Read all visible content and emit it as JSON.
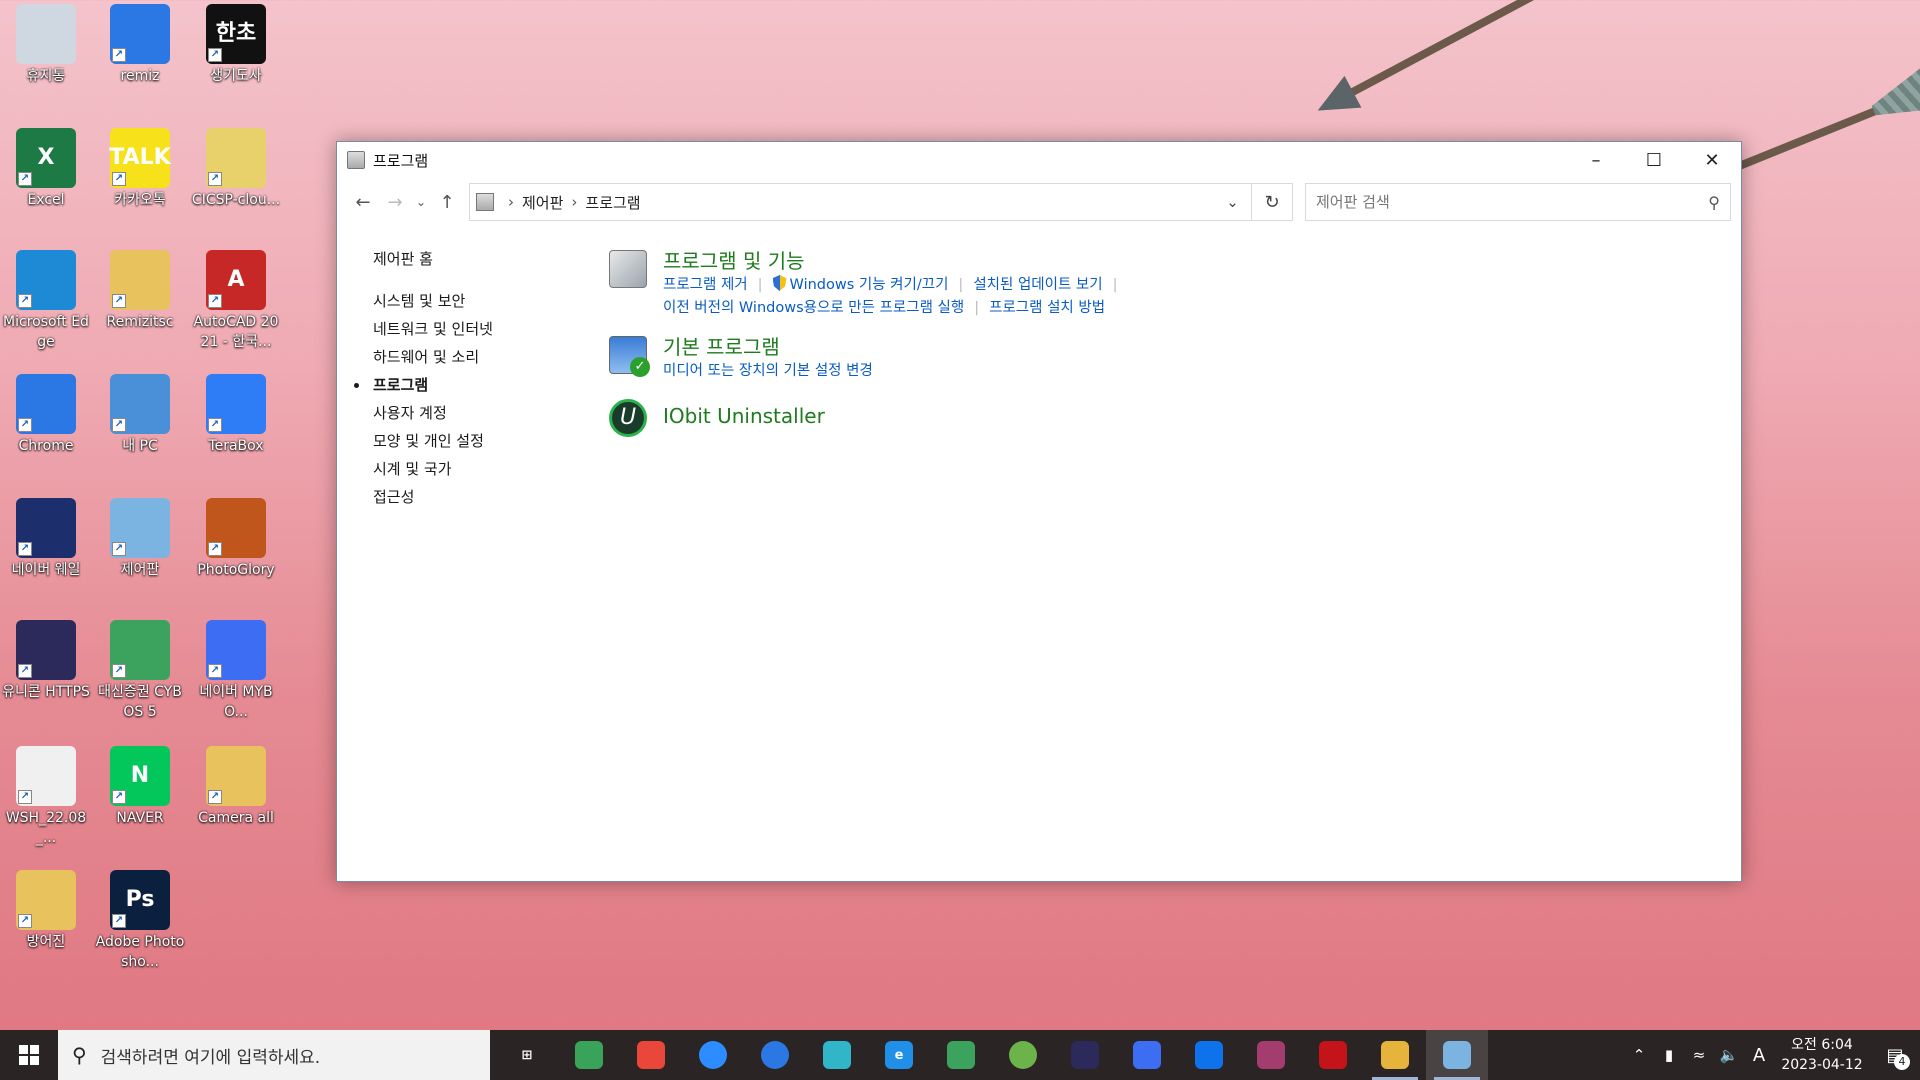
{
  "desktop": {
    "icons": [
      {
        "label": "휴지통",
        "icon": "recycle-bin-icon",
        "color": "#cfd8e0"
      },
      {
        "label": "remiz",
        "icon": "chrome-icon",
        "color": "#2b78e4"
      },
      {
        "label": "생기도사",
        "icon": "app-icon",
        "color": "#111111",
        "glyph": "한초"
      },
      {
        "label": "Excel",
        "icon": "excel-icon",
        "color": "#1d7a45",
        "glyph": "X"
      },
      {
        "label": "카카오톡",
        "icon": "kakaotalk-icon",
        "color": "#f7e11b",
        "glyph": "TALK"
      },
      {
        "label": "CICSP-clou...",
        "icon": "cloud-app-icon",
        "color": "#e8d16a"
      },
      {
        "label": "Microsoft Edge",
        "icon": "edge-icon",
        "color": "#1e8ad6"
      },
      {
        "label": "Remizitsc",
        "icon": "folder-user-icon",
        "color": "#e7c25d"
      },
      {
        "label": "AutoCAD 2021 - 한국...",
        "icon": "autocad-icon",
        "color": "#c62828",
        "glyph": "A"
      },
      {
        "label": "Chrome",
        "icon": "chrome-icon",
        "color": "#2b78e4"
      },
      {
        "label": "내 PC",
        "icon": "pc-icon",
        "color": "#4a90d9"
      },
      {
        "label": "TeraBox",
        "icon": "terabox-icon",
        "color": "#2f7df6"
      },
      {
        "label": "네이버 웨일",
        "icon": "whale-icon",
        "color": "#1c2e6b"
      },
      {
        "label": "제어판",
        "icon": "control-panel-icon",
        "color": "#7bb4e0"
      },
      {
        "label": "PhotoGlory",
        "icon": "photoglory-icon",
        "color": "#c0561c"
      },
      {
        "label": "유니콘 HTTPS",
        "icon": "unicorn-https-icon",
        "color": "#2c2a5a"
      },
      {
        "label": "대신증권 CYBOS 5",
        "icon": "cybos-icon",
        "color": "#3ba35d"
      },
      {
        "label": "네이버 MYBO...",
        "icon": "mybox-icon",
        "color": "#3d6df2"
      },
      {
        "label": "WSH_22.08_...",
        "icon": "file-icon",
        "color": "#f0f0f0"
      },
      {
        "label": "NAVER",
        "icon": "naver-icon",
        "color": "#03c75a",
        "glyph": "N"
      },
      {
        "label": "Camera all",
        "icon": "folder-photo-icon",
        "color": "#e7c25d"
      },
      {
        "label": "방어진",
        "icon": "folder-excel-icon",
        "color": "#e7c25d"
      },
      {
        "label": "Adobe Photosho...",
        "icon": "photoshop-icon",
        "color": "#0b1f3f",
        "glyph": "Ps"
      }
    ]
  },
  "window": {
    "title": "프로그램",
    "breadcrumb": [
      "제어판",
      "프로그램"
    ],
    "search_placeholder": "제어판 검색",
    "leftnav": {
      "home": "제어판 홈",
      "items": [
        {
          "label": "시스템 및 보안",
          "active": false
        },
        {
          "label": "네트워크 및 인터넷",
          "active": false
        },
        {
          "label": "하드웨어 및 소리",
          "active": false
        },
        {
          "label": "프로그램",
          "active": true
        },
        {
          "label": "사용자 계정",
          "active": false
        },
        {
          "label": "모양 및 개인 설정",
          "active": false
        },
        {
          "label": "시계 및 국가",
          "active": false
        },
        {
          "label": "접근성",
          "active": false
        }
      ]
    },
    "categories": {
      "programs_features": {
        "heading": "프로그램 및 기능",
        "link1": "프로그램 제거",
        "link2": "Windows 기능 켜기/끄기",
        "link3": "설치된 업데이트 보기",
        "link4": "이전 버전의 Windows용으로 만든 프로그램 실행",
        "link5": "프로그램 설치 방법"
      },
      "default_programs": {
        "heading": "기본 프로그램",
        "link1": "미디어 또는 장치의 기본 설정 변경"
      },
      "iobit": {
        "heading": "IObit Uninstaller"
      }
    }
  },
  "taskbar": {
    "search_placeholder": "검색하려면 여기에 입력하세요.",
    "apps": [
      {
        "name": "task-view-icon",
        "color": "#2a2424",
        "glyph": "⊞"
      },
      {
        "name": "globe-app-icon",
        "color": "#3aa35a"
      },
      {
        "name": "snap-app-icon",
        "color": "#e8473a"
      },
      {
        "name": "zoom-icon",
        "color": "#2d8cff"
      },
      {
        "name": "chrome-icon",
        "color": "#2b78e4"
      },
      {
        "name": "whale-icon",
        "color": "#30b5c9"
      },
      {
        "name": "ie-icon",
        "color": "#1f8fe8",
        "glyph": "e"
      },
      {
        "name": "green-app-icon",
        "color": "#3ba35d"
      },
      {
        "name": "utorrent-icon",
        "color": "#6bb34a"
      },
      {
        "name": "unicorn-https-icon",
        "color": "#2c2a5a"
      },
      {
        "name": "mybox-icon",
        "color": "#3d6df2"
      },
      {
        "name": "teamviewer-icon",
        "color": "#0e72ed"
      },
      {
        "name": "winrar-icon",
        "color": "#a33c6f"
      },
      {
        "name": "acrobat-icon",
        "color": "#c4141a"
      },
      {
        "name": "file-explorer-icon",
        "color": "#e7b43b"
      },
      {
        "name": "control-panel-icon",
        "color": "#7bb4e0"
      }
    ],
    "tray": {
      "ime": "A",
      "time": "오전 6:04",
      "date": "2023-04-12",
      "notifications": "4"
    }
  }
}
